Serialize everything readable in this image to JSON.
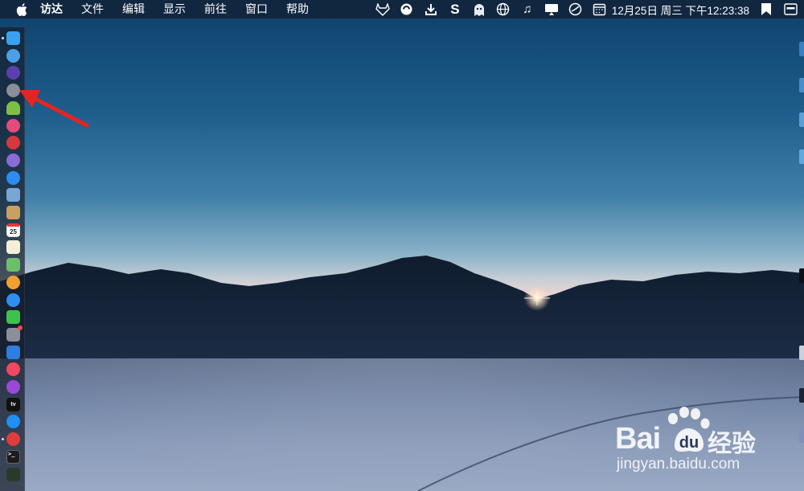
{
  "menubar": {
    "apple_icon": "apple-logo-icon",
    "items": [
      {
        "label": "访达",
        "bold": true
      },
      {
        "label": "文件"
      },
      {
        "label": "编辑"
      },
      {
        "label": "显示"
      },
      {
        "label": "前往"
      },
      {
        "label": "窗口"
      },
      {
        "label": "帮助"
      }
    ]
  },
  "status": {
    "icons": [
      "gitlab-fox-icon",
      "sync-circle-icon",
      "download-icon",
      "s-app-icon",
      "ghost-icon",
      "globe-icon",
      "music-note-icon",
      "airplay-display-icon",
      "clock-dial-icon",
      "calendar-icon"
    ],
    "datetime": "12月25日 周三 下午12:23:38",
    "trailing_icons": [
      "bookmark-icon",
      "control-center-icon"
    ]
  },
  "dock": {
    "items": [
      {
        "name": "finder",
        "icon": "finder-icon",
        "color": "#3aa0f0"
      },
      {
        "name": "app-store-legacy",
        "icon": "app-store-icon",
        "color": "#4c9fe6"
      },
      {
        "name": "siri",
        "icon": "siri-icon",
        "color": "#5b3fb0"
      },
      {
        "name": "launchpad",
        "icon": "rocket-icon",
        "color": "#8a8f99"
      },
      {
        "name": "android-studio",
        "icon": "android-icon",
        "color": "#7bc043"
      },
      {
        "name": "color-picker",
        "icon": "color-wheel-icon",
        "color": "#e24b7a"
      },
      {
        "name": "calculator-app",
        "icon": "red-app-icon",
        "color": "#d9363e"
      },
      {
        "name": "floppy-app",
        "icon": "floppy-icon",
        "color": "#8a6bd8"
      },
      {
        "name": "safari",
        "icon": "compass-icon",
        "color": "#2d8cf0"
      },
      {
        "name": "preview",
        "icon": "preview-icon",
        "color": "#7aa6d6"
      },
      {
        "name": "notes-folder",
        "icon": "folder-icon",
        "color": "#c8a060"
      },
      {
        "name": "calendar",
        "icon": "calendar-app-icon",
        "color": "#ffffff",
        "text": "25"
      },
      {
        "name": "notes",
        "icon": "notes-icon",
        "color": "#f4efd6"
      },
      {
        "name": "maps",
        "icon": "maps-icon",
        "color": "#6cbf6a"
      },
      {
        "name": "photos",
        "icon": "photos-icon",
        "color": "#f0a030"
      },
      {
        "name": "messages-blue",
        "icon": "chat-bubble-icon",
        "color": "#2f8ff0"
      },
      {
        "name": "messages",
        "icon": "message-icon",
        "color": "#3bc34a"
      },
      {
        "name": "system-preferences",
        "icon": "gear-icon",
        "color": "#8a8f99",
        "badge": true
      },
      {
        "name": "keynote",
        "icon": "keynote-icon",
        "color": "#2f7de0"
      },
      {
        "name": "music",
        "icon": "music-icon",
        "color": "#f3475f"
      },
      {
        "name": "podcasts",
        "icon": "podcast-icon",
        "color": "#9b48d8"
      },
      {
        "name": "apple-tv",
        "icon": "tv-icon",
        "color": "#111111",
        "text": "tv"
      },
      {
        "name": "app-store",
        "icon": "app-store-a-icon",
        "color": "#1f8ff5"
      },
      {
        "name": "vivaldi",
        "icon": "vivaldi-icon",
        "color": "#e03c3c"
      },
      {
        "name": "terminal",
        "icon": "terminal-icon",
        "color": "#1c1c1c"
      },
      {
        "name": "activity-monitor",
        "icon": "activity-monitor-icon",
        "color": "#2a3a2a"
      }
    ]
  },
  "watermark": {
    "brand": "Bai",
    "brand_tail": "du",
    "cn": "经验",
    "url": "jingyan.baidu.com"
  },
  "colors": {
    "menubar_bg": "#122136",
    "arrow": "#e52421",
    "sky_top": "#0e3f6a",
    "horizon": "#e8d4d6"
  }
}
